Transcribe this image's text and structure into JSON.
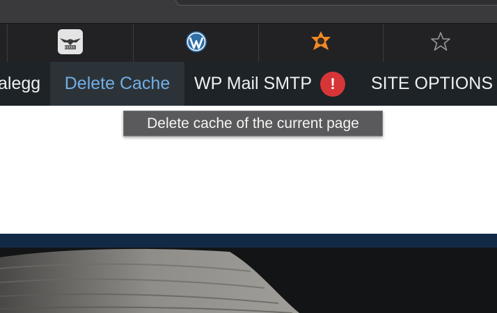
{
  "browser": {
    "bookmarks": [
      {
        "icon": "eagle-logo-icon"
      },
      {
        "icon": "wordpress-icon"
      },
      {
        "icon": "orange-gear-icon"
      },
      {
        "icon": "star-icon"
      }
    ]
  },
  "admin_bar": {
    "items": [
      {
        "label": "alegg"
      },
      {
        "label": "Delete Cache",
        "active": true
      },
      {
        "label": "WP Mail SMTP",
        "badge": "!"
      },
      {
        "label": "SITE OPTIONS"
      }
    ],
    "tooltip": "Delete cache of the current page"
  },
  "colors": {
    "admin_bar_bg": "#1d2327",
    "active_text": "#72aee6",
    "badge_bg": "#d63638",
    "band": "#122a45"
  }
}
